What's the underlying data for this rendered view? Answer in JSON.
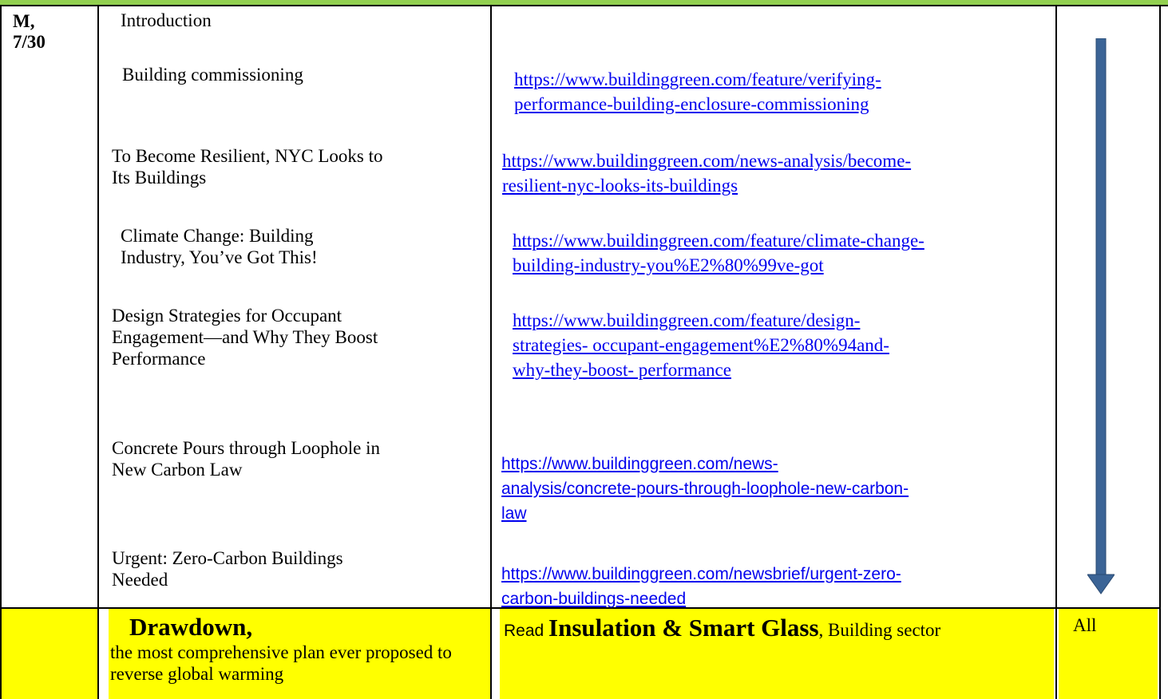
{
  "row": {
    "date_line1": "M,",
    "date_line2": "7/30",
    "topics": [
      {
        "title_lines": [
          "Introduction"
        ],
        "link_lines": []
      },
      {
        "title_lines": [
          "Building commissioning"
        ],
        "link_lines": [
          "https://www.buildinggreen.com/feature/verifying-",
          "performance-building-enclosure-commissioning"
        ]
      },
      {
        "title_lines": [
          "To Become Resilient, NYC Looks  to",
          "Its Buildings"
        ],
        "link_lines": [
          "https://www.buildinggreen.com/news-analysis/become-",
          "resilient-nyc-looks-its-buildings"
        ]
      },
      {
        "title_lines": [
          "Climate Change: Building",
          "Industry, You’ve Got This!"
        ],
        "link_lines": [
          "https://www.buildinggreen.com/feature/climate-change-",
          "building-industry-you%E2%80%99ve-got"
        ]
      },
      {
        "title_lines": [
          "Design Strategies for Occupant",
          "Engagement—and Why They  Boost",
          "Performance"
        ],
        "link_lines": [
          "https://www.buildinggreen.com/feature/design-",
          "strategies-  occupant-engagement%E2%80%94and-",
          "why-they-boost-  performance"
        ]
      },
      {
        "title_lines": [
          "Concrete Pours through Loophole in",
          "New Carbon Law"
        ],
        "link_lines": [
          "https://www.buildinggreen.com/news-",
          "analysis/concrete-pours-through-loophole-new-carbon-",
          "law"
        ]
      },
      {
        "title_lines": [
          "Urgent: Zero-Carbon Buildings",
          "Needed"
        ],
        "link_lines": [
          "https://www.buildinggreen.com/newsbrief/urgent-zero-",
          "carbon-buildings-needed"
        ]
      }
    ],
    "arrow_icon": "down-arrow-icon",
    "arrow_color": "#3b6496"
  },
  "drawdown_row": {
    "title": "Drawdown,",
    "subtitle": "the most comprehensive plan ever proposed to reverse global warming",
    "read_word": "Read ",
    "read_bold": "Insulation & Smart Glass",
    "read_rest": ", Building sector",
    "assignee": "All",
    "highlight_color": "#ffff00"
  },
  "header_color": "#92d050",
  "link_color": "#0000ee"
}
